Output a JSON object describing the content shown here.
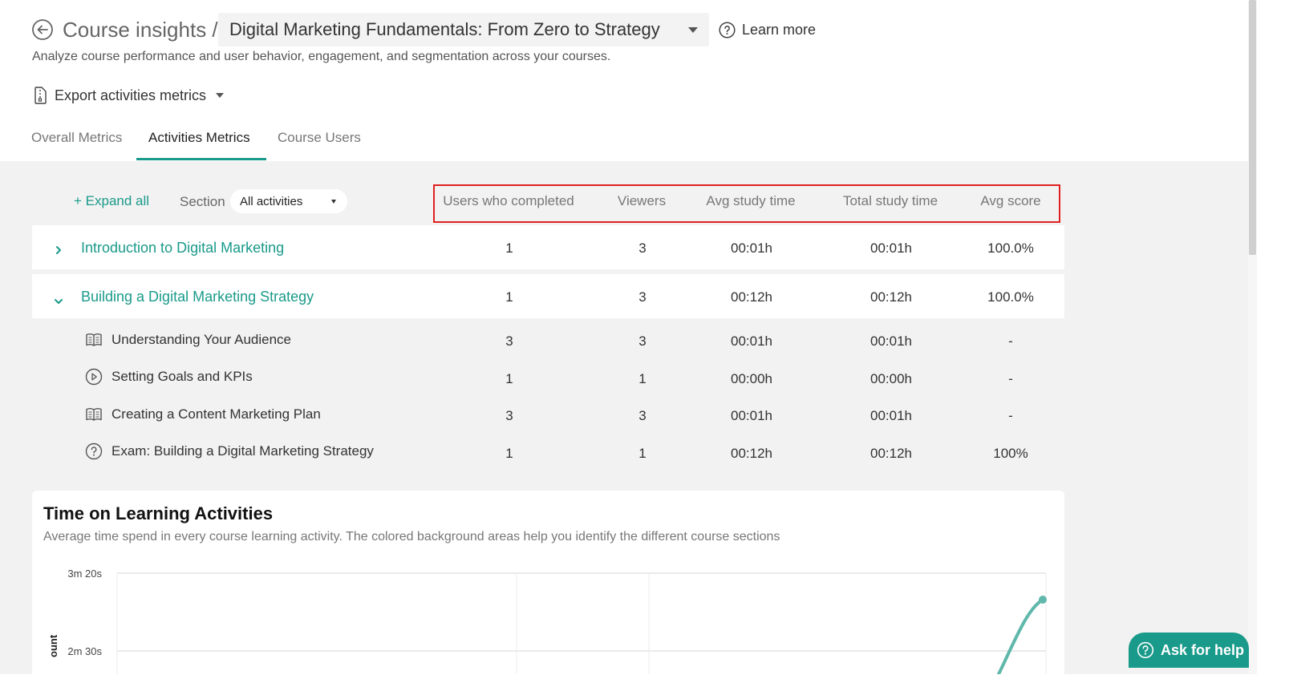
{
  "header": {
    "title": "Course insights /",
    "course_selected": "Digital Marketing Fundamentals: From Zero to Strategy",
    "learn_more": "Learn more",
    "subtitle": "Analyze course performance and user behavior, engagement, and segmentation across your courses.",
    "export_label": "Export activities metrics"
  },
  "tabs": [
    {
      "label": "Overall Metrics",
      "active": false
    },
    {
      "label": "Activities Metrics",
      "active": true
    },
    {
      "label": "Course Users",
      "active": false
    }
  ],
  "toolbar": {
    "expand_all": "+ Expand all",
    "section_label": "Section",
    "section_value": "All activities"
  },
  "columns": [
    "Users who completed",
    "Viewers",
    "Avg study time",
    "Total study time",
    "Avg score"
  ],
  "sections": [
    {
      "title": "Introduction to Digital Marketing",
      "expanded": false,
      "values": [
        "1",
        "3",
        "00:01h",
        "00:01h",
        "100.0%"
      ]
    },
    {
      "title": "Building a Digital Marketing Strategy",
      "expanded": true,
      "values": [
        "1",
        "3",
        "00:12h",
        "00:12h",
        "100.0%"
      ],
      "activities": [
        {
          "icon": "book-icon",
          "title": "Understanding Your Audience",
          "values": [
            "3",
            "3",
            "00:01h",
            "00:01h",
            "-"
          ]
        },
        {
          "icon": "play-circle-icon",
          "title": "Setting Goals and KPIs",
          "values": [
            "1",
            "1",
            "00:00h",
            "00:00h",
            "-"
          ]
        },
        {
          "icon": "book-icon",
          "title": "Creating a Content Marketing Plan",
          "values": [
            "3",
            "3",
            "00:01h",
            "00:01h",
            "-"
          ]
        },
        {
          "icon": "question-circle-icon",
          "title": "Exam: Building a Digital Marketing Strategy",
          "values": [
            "1",
            "1",
            "00:12h",
            "00:12h",
            "100%"
          ]
        }
      ]
    }
  ],
  "chart": {
    "title": "Time on Learning Activities",
    "subtitle": "Average time spend in every course learning activity. The colored background areas help you identify the different course sections",
    "y_label": "ount",
    "accent_color": "#1a9a8a"
  },
  "chart_data": {
    "type": "line",
    "title": "Time on Learning Activities",
    "ylabel": "ount",
    "yticks": [
      "3m 20s",
      "2m 30s"
    ],
    "ylim_seconds": [
      150,
      200
    ],
    "grid": true,
    "series": [
      {
        "visible_points_seconds": [
          197
        ]
      }
    ]
  },
  "help_button": "Ask for help"
}
